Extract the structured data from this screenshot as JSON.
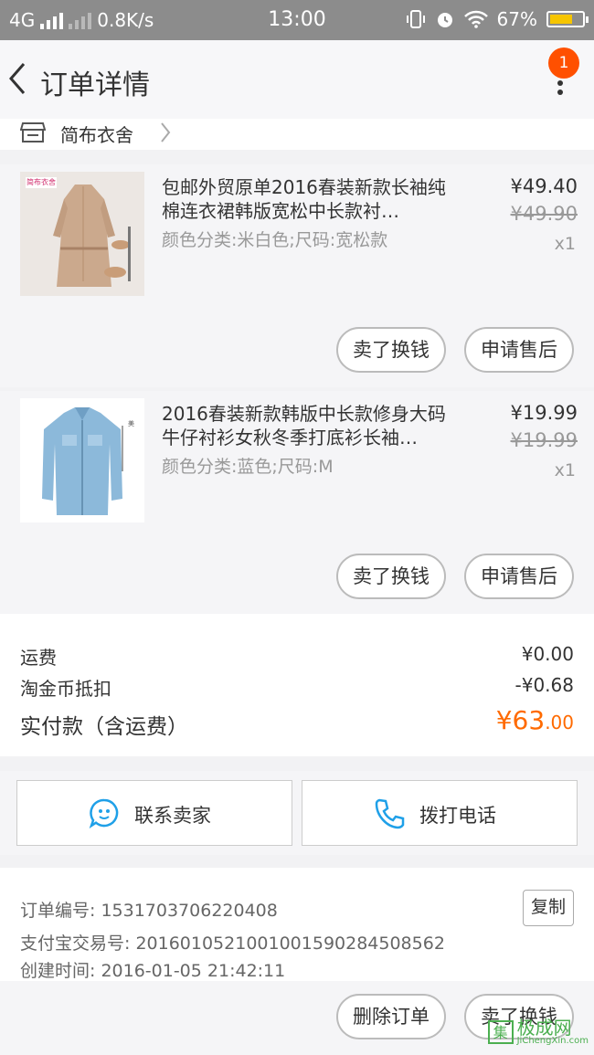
{
  "status_bar": {
    "network": "4G",
    "speed": "0.8K/s",
    "time": "13:00",
    "battery": "67%",
    "battery_color": "#f6c500"
  },
  "navbar": {
    "title": "订单详情",
    "badge": "1",
    "badge_color": "#ff5000"
  },
  "shop": {
    "name": "简布衣舍"
  },
  "items": [
    {
      "title": "包邮外贸原单2016春装新款长袖纯棉连衣裙韩版宽松中长款衬…",
      "sku": "颜色分类:米白色;尺码:宽松款",
      "price": "¥49.40",
      "orig_price": "¥49.90",
      "qty": "x1",
      "thumb_tag": "简布衣舍",
      "btn_sell": "卖了换钱",
      "btn_after": "申请售后"
    },
    {
      "title": "2016春装新款韩版中长款修身大码牛仔衬衫女秋冬季打底衫长袖…",
      "sku": "颜色分类:蓝色;尺码:M",
      "price": "¥19.99",
      "orig_price": "¥19.99",
      "qty": "x1",
      "btn_sell": "卖了换钱",
      "btn_after": "申请售后"
    }
  ],
  "summary": {
    "shipping_label": "运费",
    "shipping_value": "¥0.00",
    "coin_label": "淘金币抵扣",
    "coin_value": "-¥0.68",
    "paid_label": "实付款（含运费）",
    "paid_int": "¥63",
    "paid_dec": ".00",
    "accent_color": "#ff6a00"
  },
  "contact": {
    "seller_label": "联系卖家",
    "call_label": "拨打电话",
    "icon_color": "#1fa0e8"
  },
  "order_info": {
    "order_no": "订单编号: 1531703706220408",
    "copy_label": "复制",
    "alipay_no": "支付宝交易号: 2016010521001001590284508562",
    "created": "创建时间: 2016-01-05 21:42:11"
  },
  "bottom": {
    "delete_label": "删除订单",
    "sell_label": "卖了换钱"
  },
  "watermark": {
    "box_char": "集",
    "name": "极成网",
    "url": "JiChengXin.com"
  }
}
